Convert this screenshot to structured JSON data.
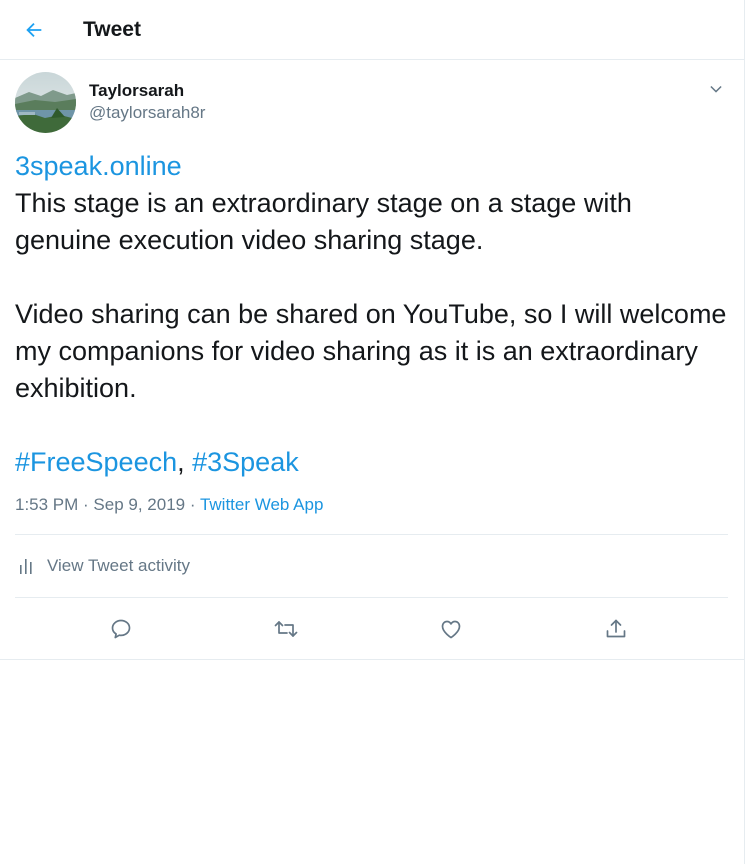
{
  "header": {
    "title": "Tweet",
    "back_icon": "arrow-left-icon"
  },
  "tweet": {
    "author": {
      "display_name": "Taylorsarah",
      "username": "@taylorsarah8r"
    },
    "link_text": "3speak.online",
    "paragraph1": "This stage is an extraordinary stage on a stage with genuine execution video sharing stage.",
    "paragraph2": "Video sharing can be shared on YouTube, so I will welcome my companions for video sharing as it is an extraordinary exhibition.",
    "hashtag1": "#FreeSpeech",
    "hashtag_separator": ", ",
    "hashtag2": "#3Speak",
    "time": "1:53 PM",
    "date": "Sep 9, 2019",
    "separator": " · ",
    "source": "Twitter Web App",
    "activity_label": "View Tweet activity"
  },
  "actions": {
    "reply_icon": "reply-icon",
    "retweet_icon": "retweet-icon",
    "like_icon": "heart-icon",
    "share_icon": "share-icon"
  },
  "colors": {
    "accent": "#1b95e0",
    "text": "#14171a",
    "secondary": "#657786",
    "border": "#e6ecf0"
  }
}
